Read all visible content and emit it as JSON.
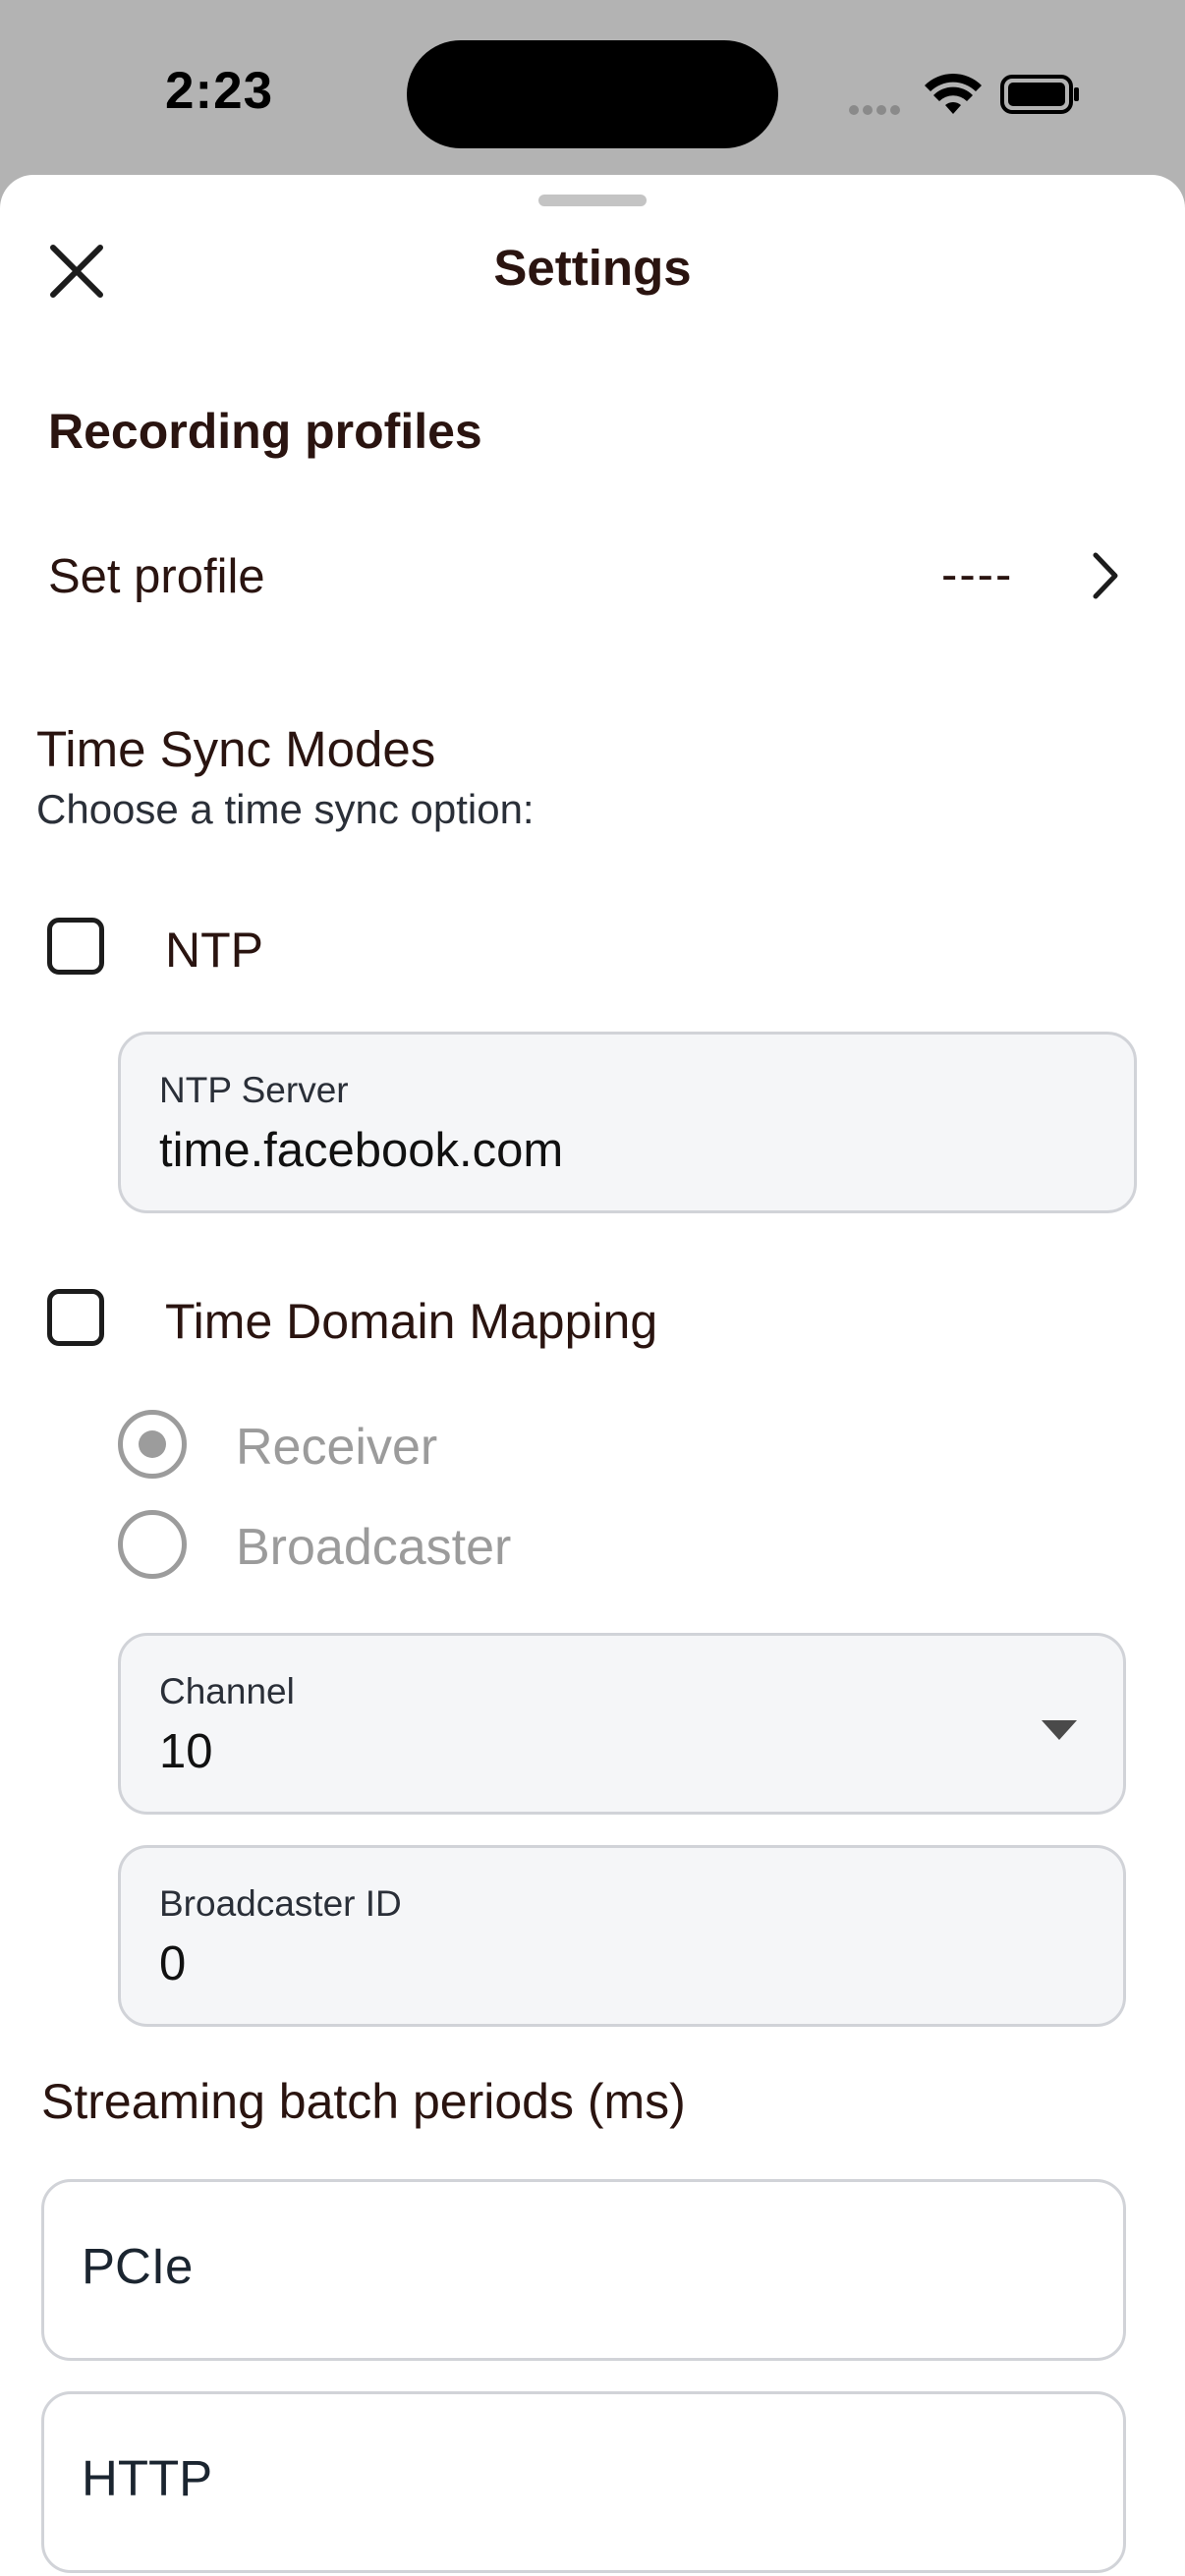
{
  "status_bar": {
    "time": "2:23"
  },
  "header": {
    "title": "Settings"
  },
  "recording_profiles": {
    "heading": "Recording profiles",
    "set_profile_label": "Set profile",
    "set_profile_value": "----"
  },
  "time_sync": {
    "heading": "Time Sync Modes",
    "subheading": "Choose a time sync option:",
    "ntp": {
      "label": "NTP",
      "checked": false,
      "server_field": {
        "label": "NTP Server",
        "value": "time.facebook.com"
      }
    },
    "tdm": {
      "label": "Time Domain Mapping",
      "checked": false,
      "roles": [
        {
          "label": "Receiver",
          "selected": true
        },
        {
          "label": "Broadcaster",
          "selected": false
        }
      ],
      "channel_field": {
        "label": "Channel",
        "value": "10"
      },
      "broadcaster_id_field": {
        "label": "Broadcaster ID",
        "value": "0"
      }
    }
  },
  "streaming": {
    "heading": "Streaming batch periods (ms)",
    "fields": [
      {
        "placeholder": "PCIe"
      },
      {
        "placeholder": "HTTP"
      }
    ]
  },
  "colors": {
    "sheet": "#ffffff",
    "backdrop": "#b3b3b3",
    "text_primary": "#2a1410",
    "disabled": "#9c9c9c",
    "field_bg": "#f5f6f8",
    "field_border": "#d1d3d8"
  },
  "icons": [
    "close-icon",
    "chevron-right-icon",
    "wifi-icon",
    "battery-icon",
    "dropdown-caret-icon"
  ]
}
